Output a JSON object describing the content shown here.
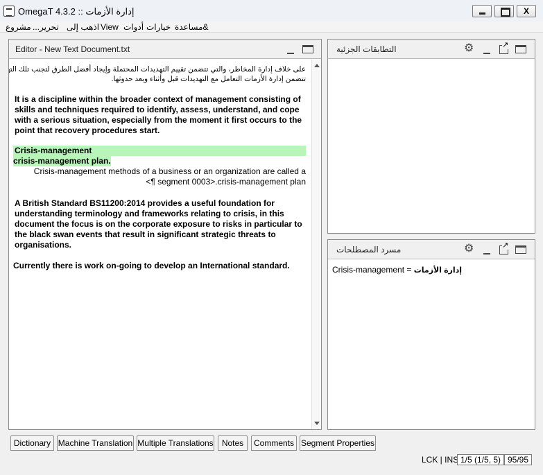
{
  "window": {
    "title": "OmegaT 4.3.2 :: إدارة الأزمات",
    "close_label": "X"
  },
  "menu": [
    "مشروع",
    "...تحرير",
    "اذهب إلى",
    "View",
    "أدوات",
    "خيارات",
    "مساعدة&"
  ],
  "editor": {
    "title": "Editor - New Text Document.txt",
    "arabic_line1": "على خلاف إدارة المخاطر، والتي تتضمن تقييم التهديدات المحتملة وإيجاد أفضل الطرق لتجنب تلك التهديدات،",
    "arabic_line2": "تتضمن إدارة الأزمات التعامل مع التهديدات قبل وأثناء وبعد حدوثها.",
    "segments": [
      "It is a discipline within the broader context of management consisting of skills and techniques required to identify, assess, understand, and cope with a serious situation, especially from the moment it first occurs to the point that recovery procedures start.",
      "Crisis-management",
      "crisis-management plan.",
      "Crisis-management methods of a business or an organization are called a",
      "<¶ segment 0003>.crisis-management plan",
      "A British Standard BS11200:2014 provides a useful foundation for understanding terminology and frameworks relating to crisis, in this document the focus is on the corporate exposure to risks in particular to the black swan events that result in significant strategic threats to organisations.",
      "Currently there is work on-going to develop an International standard."
    ]
  },
  "fuzzy_panel": {
    "title": "التطابقات الجزئية"
  },
  "glossary_panel": {
    "title": "مسرد المصطلحات",
    "entry_source": "Crisis-management =",
    "entry_target": "إدارة الأزمات"
  },
  "tabs": [
    "Dictionary",
    "Machine Translation",
    "Multiple Translations",
    "Notes",
    "Comments",
    "Segment Properties"
  ],
  "status": {
    "mode": "LCK | INS",
    "progress": "1/5 (1/5, 5)",
    "percent": "95/95"
  }
}
